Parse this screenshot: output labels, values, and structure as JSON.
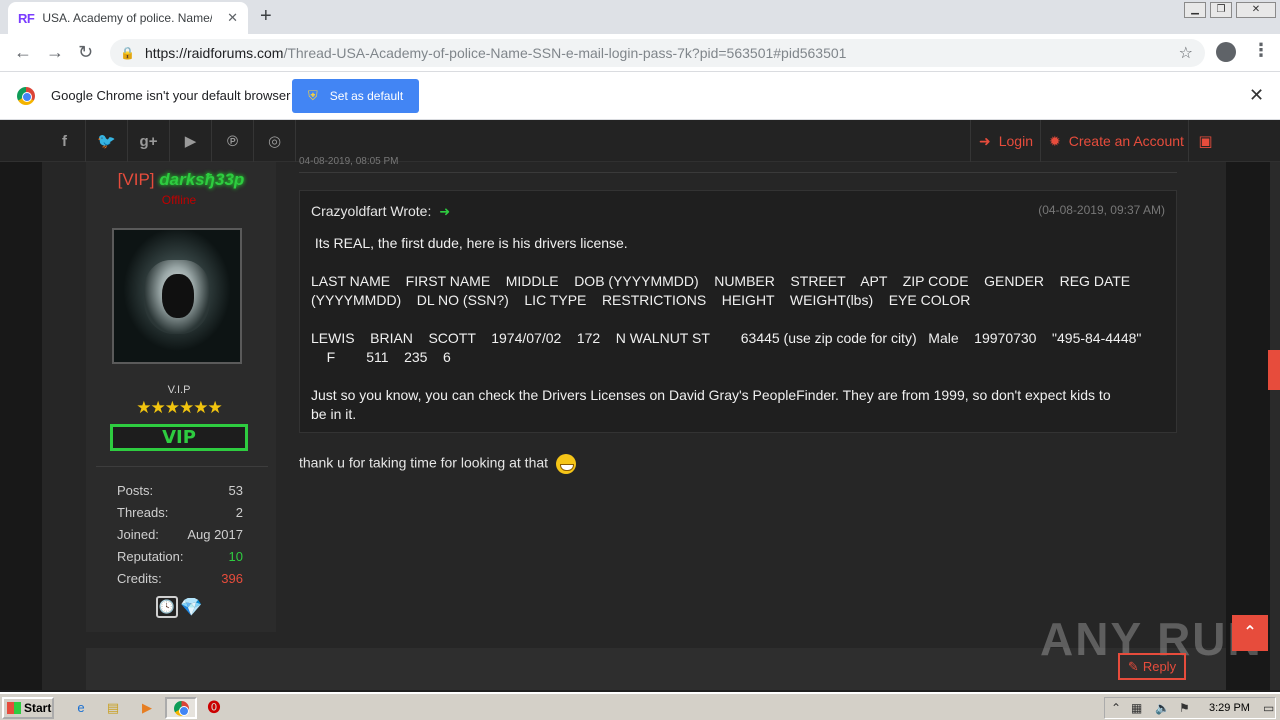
{
  "browser": {
    "tab_title": "USA. Academy of police. Name/SSN/",
    "favicon": "RF",
    "url_host": "https://raidforums.com",
    "url_path": "/Thread-USA-Academy-of-police-Name-SSN-e-mail-login-pass-7k?pid=563501#pid563501",
    "infobar_message": "Google Chrome isn't your default browser",
    "set_default_label": "Set as default"
  },
  "site_nav": {
    "login_label": "Login",
    "create_account_label": "Create an Account"
  },
  "profile": {
    "rank_prefix": "[VIP]",
    "username": "darksђ33p",
    "status": "Offline",
    "rank_title": "V.I.P",
    "stars": "★★★★★★",
    "badge": "VIP",
    "stats": [
      {
        "label": "Posts:",
        "value": "53"
      },
      {
        "label": "Threads:",
        "value": "2"
      },
      {
        "label": "Joined:",
        "value": "Aug 2017"
      },
      {
        "label": "Reputation:",
        "value": "10"
      },
      {
        "label": "Credits:",
        "value": "396"
      }
    ]
  },
  "post": {
    "date_top": "04-08-2019, 08:05 PM",
    "quote_author": "Crazyoldfart Wrote:",
    "quote_date": "(04-08-2019, 09:37 AM)",
    "quote_lines": [
      " Its REAL, the first dude, here is his drivers license.",
      "LAST NAME    FIRST NAME    MIDDLE    DOB (YYYYMMDD)    NUMBER    STREET    APT    ZIP CODE    GENDER    REG DATE",
      "(YYYYMMDD)    DL NO (SSN?)    LIC TYPE    RESTRICTIONS    HEIGHT    WEIGHT(lbs)    EYE COLOR",
      "LEWIS    BRIAN    SCOTT    1974/07/02    172    N WALNUT ST        63445 (use zip code for city)   Male    19970730    \"495-84-4448\"",
      "    F        511    235    6",
      "Just so you know, you can check the Drivers Licenses on David Gray's PeopleFinder. They are from 1999, so don't expect kids to",
      "be in it."
    ],
    "reply_text": "thank u for taking time for looking at that",
    "reply_button": "Reply"
  },
  "watermark": "ANY RUN",
  "taskbar": {
    "start_label": "Start",
    "clock": "3:29 PM"
  },
  "colors": {
    "accent": "#e74c3c",
    "vip_green": "#2ecc40",
    "chrome_blue": "#4285f4"
  }
}
